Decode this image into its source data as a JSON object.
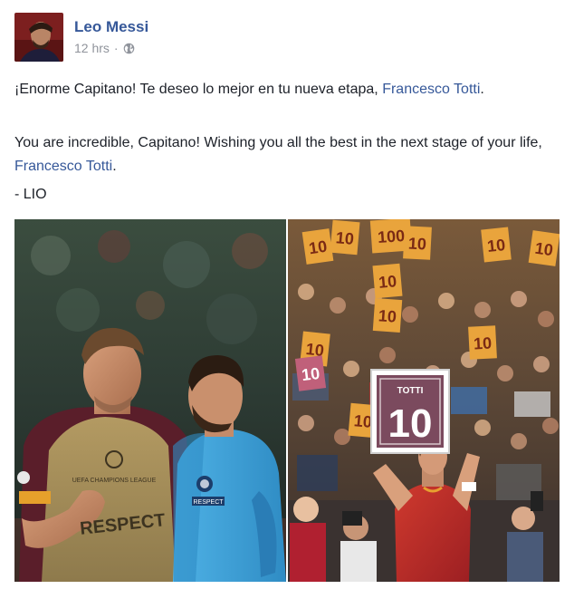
{
  "post": {
    "author": "Leo Messi",
    "time": "12 hrs",
    "separator": "·",
    "privacy_icon": "globe-icon",
    "paragraph1": {
      "text": "¡Enorme Capitano! Te deseo lo mejor en tu nueva etapa, ",
      "mention": "Francesco Totti",
      "end": "."
    },
    "paragraph2": {
      "text": "You are incredible, Capitano! Wishing you all the best in the next stage of your life, ",
      "mention": "Francesco Totti",
      "end": "."
    },
    "signature": "- LIO"
  },
  "photo_right": {
    "board_title": "TOTTI",
    "board_number": "10",
    "fan_signs": [
      "10",
      "10",
      "100",
      "10",
      "10",
      "10",
      "10",
      "10",
      "10",
      "10",
      "10",
      "10"
    ]
  },
  "photo_left": {
    "bib_text": "RESPECT",
    "bib_sub": "UEFA CHAMPIONS LEAGUE",
    "patch_text": "RESPECT"
  },
  "colors": {
    "link": "#365899",
    "meta": "#90949c",
    "text": "#1d2129",
    "roma_red": "#b8232f",
    "barca_blue": "#3b9fd8",
    "sign_orange": "#e9a43c"
  }
}
